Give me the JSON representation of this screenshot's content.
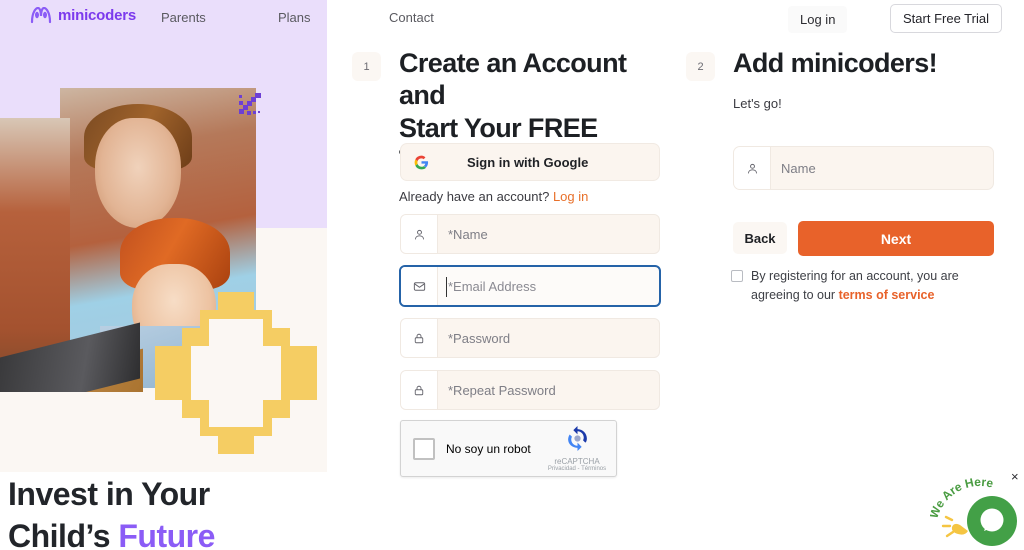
{
  "brand": {
    "logo_text": "minicoders",
    "purple": "#7c3aed",
    "orange": "#e8622a",
    "lavender": "#eadefb",
    "cream": "#fbf7f3",
    "yellow": "#f5cd63"
  },
  "nav": {
    "links": [
      {
        "label": "Parents"
      },
      {
        "label": "Plans"
      },
      {
        "label": "Contact"
      }
    ],
    "login_label": "Log in",
    "trial_label": "Start Free Trial"
  },
  "hero": {
    "heading_line1": "Invest in Your",
    "heading_line2_plain": "Child’s ",
    "heading_line2_accent": "Future"
  },
  "step1": {
    "number": "1",
    "title_line1": "Create an Account and",
    "title_line2": "Start Your FREE TRIAL",
    "subtitle_text": "Already have an account? ",
    "subtitle_link": "Log in",
    "google_button": "Sign in with Google",
    "fields": [
      {
        "placeholder": "*Name",
        "icon": "user-icon",
        "focused": false
      },
      {
        "placeholder": "*Email Address",
        "icon": "envelope-icon",
        "focused": true
      },
      {
        "placeholder": "*Password",
        "icon": "lock-icon",
        "focused": false
      },
      {
        "placeholder": "*Repeat Password",
        "icon": "lock-icon",
        "focused": false
      }
    ],
    "recaptcha": {
      "label": "No soy un robot",
      "brand": "reCAPTCHA",
      "legal": "Privacidad - Términos"
    }
  },
  "step2": {
    "number": "2",
    "title": "Add minicoders!",
    "subtitle": "Let's go!",
    "name_field": {
      "placeholder": "Name",
      "icon": "user-icon"
    },
    "back_label": "Back",
    "next_label": "Next",
    "terms_text_before": "By registering for an account, you are agreeing to our ",
    "terms_link": "terms of service"
  },
  "chat": {
    "bubble_text": "We Are Here",
    "close_label": "×"
  }
}
